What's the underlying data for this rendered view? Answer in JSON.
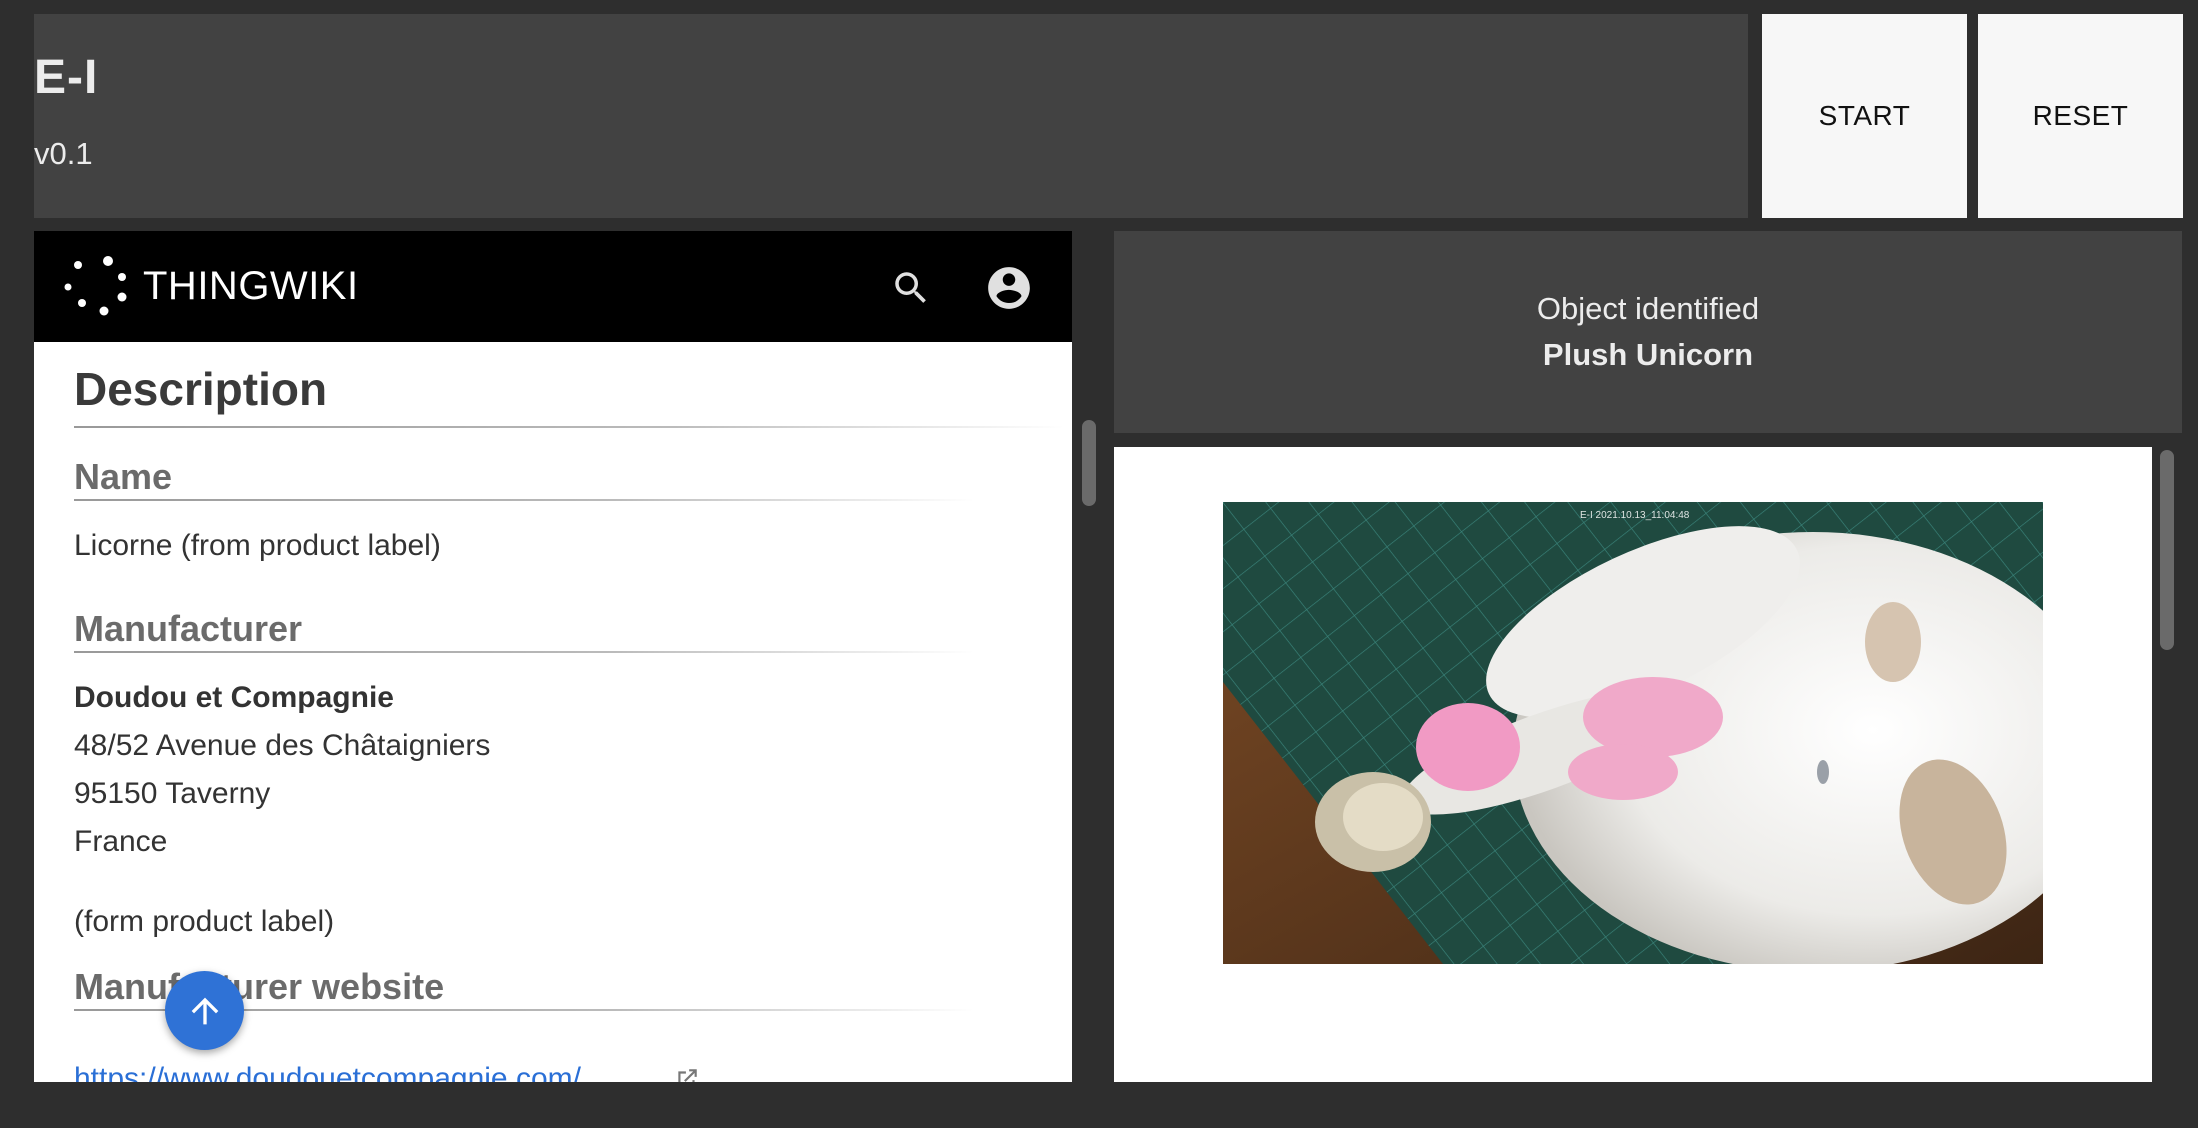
{
  "header": {
    "title": "E-I",
    "version": "v0.1",
    "start_label": "START",
    "reset_label": "RESET"
  },
  "wiki": {
    "brand": "THINGWIKI",
    "description_heading": "Description",
    "name_heading": "Name",
    "name_value": "Licorne (from product label)",
    "manufacturer_heading": "Manufacturer",
    "manufacturer_name": "Doudou et Compagnie",
    "manufacturer_address_line1": "48/52 Avenue des Châtaigniers",
    "manufacturer_address_line2": "95150 Taverny",
    "manufacturer_country": "France",
    "manufacturer_note": "(form product label)",
    "website_heading": "Manufacturer website",
    "website_link": "https://www.doudouetcompagnie.com/"
  },
  "identification": {
    "label": "Object identified",
    "object": "Plush Unicorn"
  },
  "photo": {
    "stamp": "E-I 2021.10.13_11:04:48"
  },
  "colors": {
    "background": "#2e2e2e",
    "panel": "#424242",
    "accent": "#2f72d6",
    "link": "#2a6fd6"
  },
  "icons": [
    "thingwiki-logo-icon",
    "search-icon",
    "account-circle-icon",
    "external-link-icon",
    "arrow-up-icon"
  ]
}
